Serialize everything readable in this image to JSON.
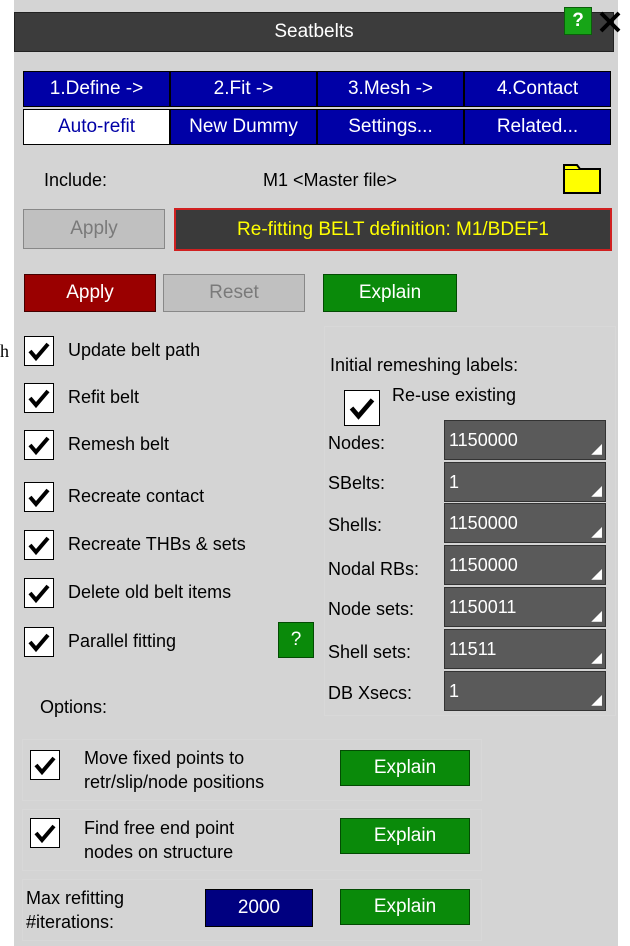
{
  "window": {
    "title": "Seatbelts",
    "help_label": "?",
    "close_label": "✕"
  },
  "tabs_row1": [
    "1.Define ->",
    "2.Fit ->",
    "3.Mesh ->",
    "4.Contact"
  ],
  "tabs_row2": [
    "Auto-refit",
    "New Dummy",
    "Settings...",
    "Related..."
  ],
  "include": {
    "label": "Include:",
    "value": "M1  <Master file>"
  },
  "header_apply": {
    "label": "Apply",
    "status": "Re-fitting BELT definition: M1/BDEF1"
  },
  "actions": {
    "apply": "Apply",
    "reset": "Reset",
    "explain": "Explain"
  },
  "left_edge_fragment": "h",
  "checkboxes": [
    {
      "label": "Update belt path",
      "checked": true
    },
    {
      "label": "Refit belt",
      "checked": true
    },
    {
      "label": "Remesh belt",
      "checked": true
    },
    {
      "label": "Recreate contact",
      "checked": true
    },
    {
      "label": "Recreate THBs & sets",
      "checked": true
    },
    {
      "label": "Delete old belt items",
      "checked": true
    },
    {
      "label": "Parallel fitting",
      "checked": true
    }
  ],
  "parallel_help": "?",
  "options_label": "Options:",
  "remesh": {
    "title": "Initial remeshing labels:",
    "reuse_label": "Re-use existing",
    "fields": [
      {
        "label": "Nodes:",
        "value": "1150000"
      },
      {
        "label": "SBelts:",
        "value": "1"
      },
      {
        "label": "Shells:",
        "value": "1150000"
      },
      {
        "label": "Nodal RBs:",
        "value": "1150000"
      },
      {
        "label": "Node sets:",
        "value": "1150011"
      },
      {
        "label": "Shell sets:",
        "value": "11511"
      },
      {
        "label": "DB Xsecs:",
        "value": "1"
      }
    ]
  },
  "option_rows": [
    {
      "line1": "Move fixed points to",
      "line2": "retr/slip/node positions",
      "explain": "Explain"
    },
    {
      "line1": "Find free end point",
      "line2": "nodes on structure",
      "explain": "Explain"
    }
  ],
  "max_refit": {
    "line1": "Max refitting",
    "line2": "#iterations:",
    "value": "2000",
    "explain": "Explain"
  },
  "colors": {
    "tab_blue": "#0000a6",
    "apply_red": "#9a0000",
    "explain_green": "#0a8a0a",
    "status_yellow": "#ffff00",
    "status_border_red": "#d02020"
  }
}
